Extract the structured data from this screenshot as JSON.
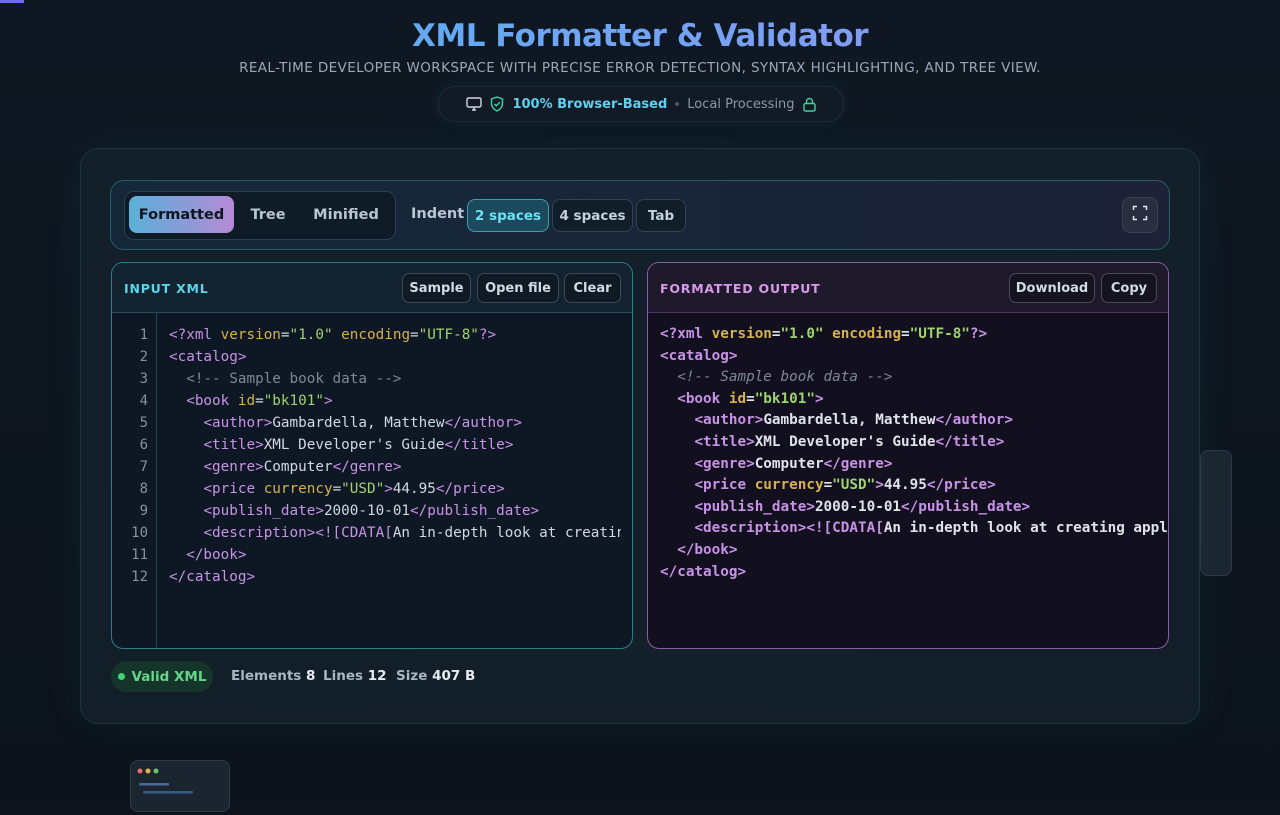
{
  "header": {
    "title": "XML Formatter & Validator",
    "subtitle": "REAL-TIME DEVELOPER WORKSPACE WITH PRECISE ERROR DETECTION, SYNTAX HIGHLIGHTING, AND TREE VIEW.",
    "badge_primary": "100% Browser-Based",
    "badge_secondary": "Local Processing"
  },
  "toolbar": {
    "modes": [
      "Formatted",
      "Tree",
      "Minified"
    ],
    "active_mode": "Formatted",
    "indent_label": "Indent",
    "indent_options": [
      "2 spaces",
      "4 spaces",
      "Tab"
    ],
    "active_indent": "2 spaces"
  },
  "input_panel": {
    "title": "INPUT XML",
    "buttons": [
      "Sample",
      "Open file",
      "Clear"
    ],
    "line_numbers": [
      "1",
      "2",
      "3",
      "4",
      "5",
      "6",
      "7",
      "8",
      "9",
      "10",
      "11",
      "12"
    ],
    "lines": [
      "<?xml version=\"1.0\" encoding=\"UTF-8\"?>",
      "<catalog>",
      "  <!-- Sample book data -->",
      "  <book id=\"bk101\">",
      "    <author>Gambardella, Matthew</author>",
      "    <title>XML Developer's Guide</title>",
      "    <genre>Computer</genre>",
      "    <price currency=\"USD\">44.95</price>",
      "    <publish_date>2000-10-01</publish_date>",
      "    <description><![CDATA[An in-depth look at creating",
      "  </book>",
      "</catalog>"
    ]
  },
  "output_panel": {
    "title": "FORMATTED OUTPUT",
    "buttons": [
      "Download",
      "Copy"
    ],
    "lines": [
      "<?xml version=\"1.0\" encoding=\"UTF-8\"?>",
      "<catalog>",
      "  <!-- Sample book data -->",
      "  <book id=\"bk101\">",
      "    <author>Gambardella, Matthew</author>",
      "    <title>XML Developer's Guide</title>",
      "    <genre>Computer</genre>",
      "    <price currency=\"USD\">44.95</price>",
      "    <publish_date>2000-10-01</publish_date>",
      "    <description><![CDATA[An in-depth look at creating applicat",
      "  </book>",
      "</catalog>"
    ]
  },
  "status": {
    "valid_label": "Valid XML",
    "elements_label": "Elements",
    "elements_value": "8",
    "lines_label": "Lines",
    "lines_value": "12",
    "size_label": "Size",
    "size_value": "407 B"
  },
  "colors": {
    "accent_cyan": "#59d6ec",
    "accent_purple": "#d89ae8",
    "valid_green": "#63d68a",
    "xml_tag": "#c893e6",
    "xml_attr": "#d6b24e",
    "xml_string": "#9fd36e",
    "xml_comment": "#7d8894"
  }
}
